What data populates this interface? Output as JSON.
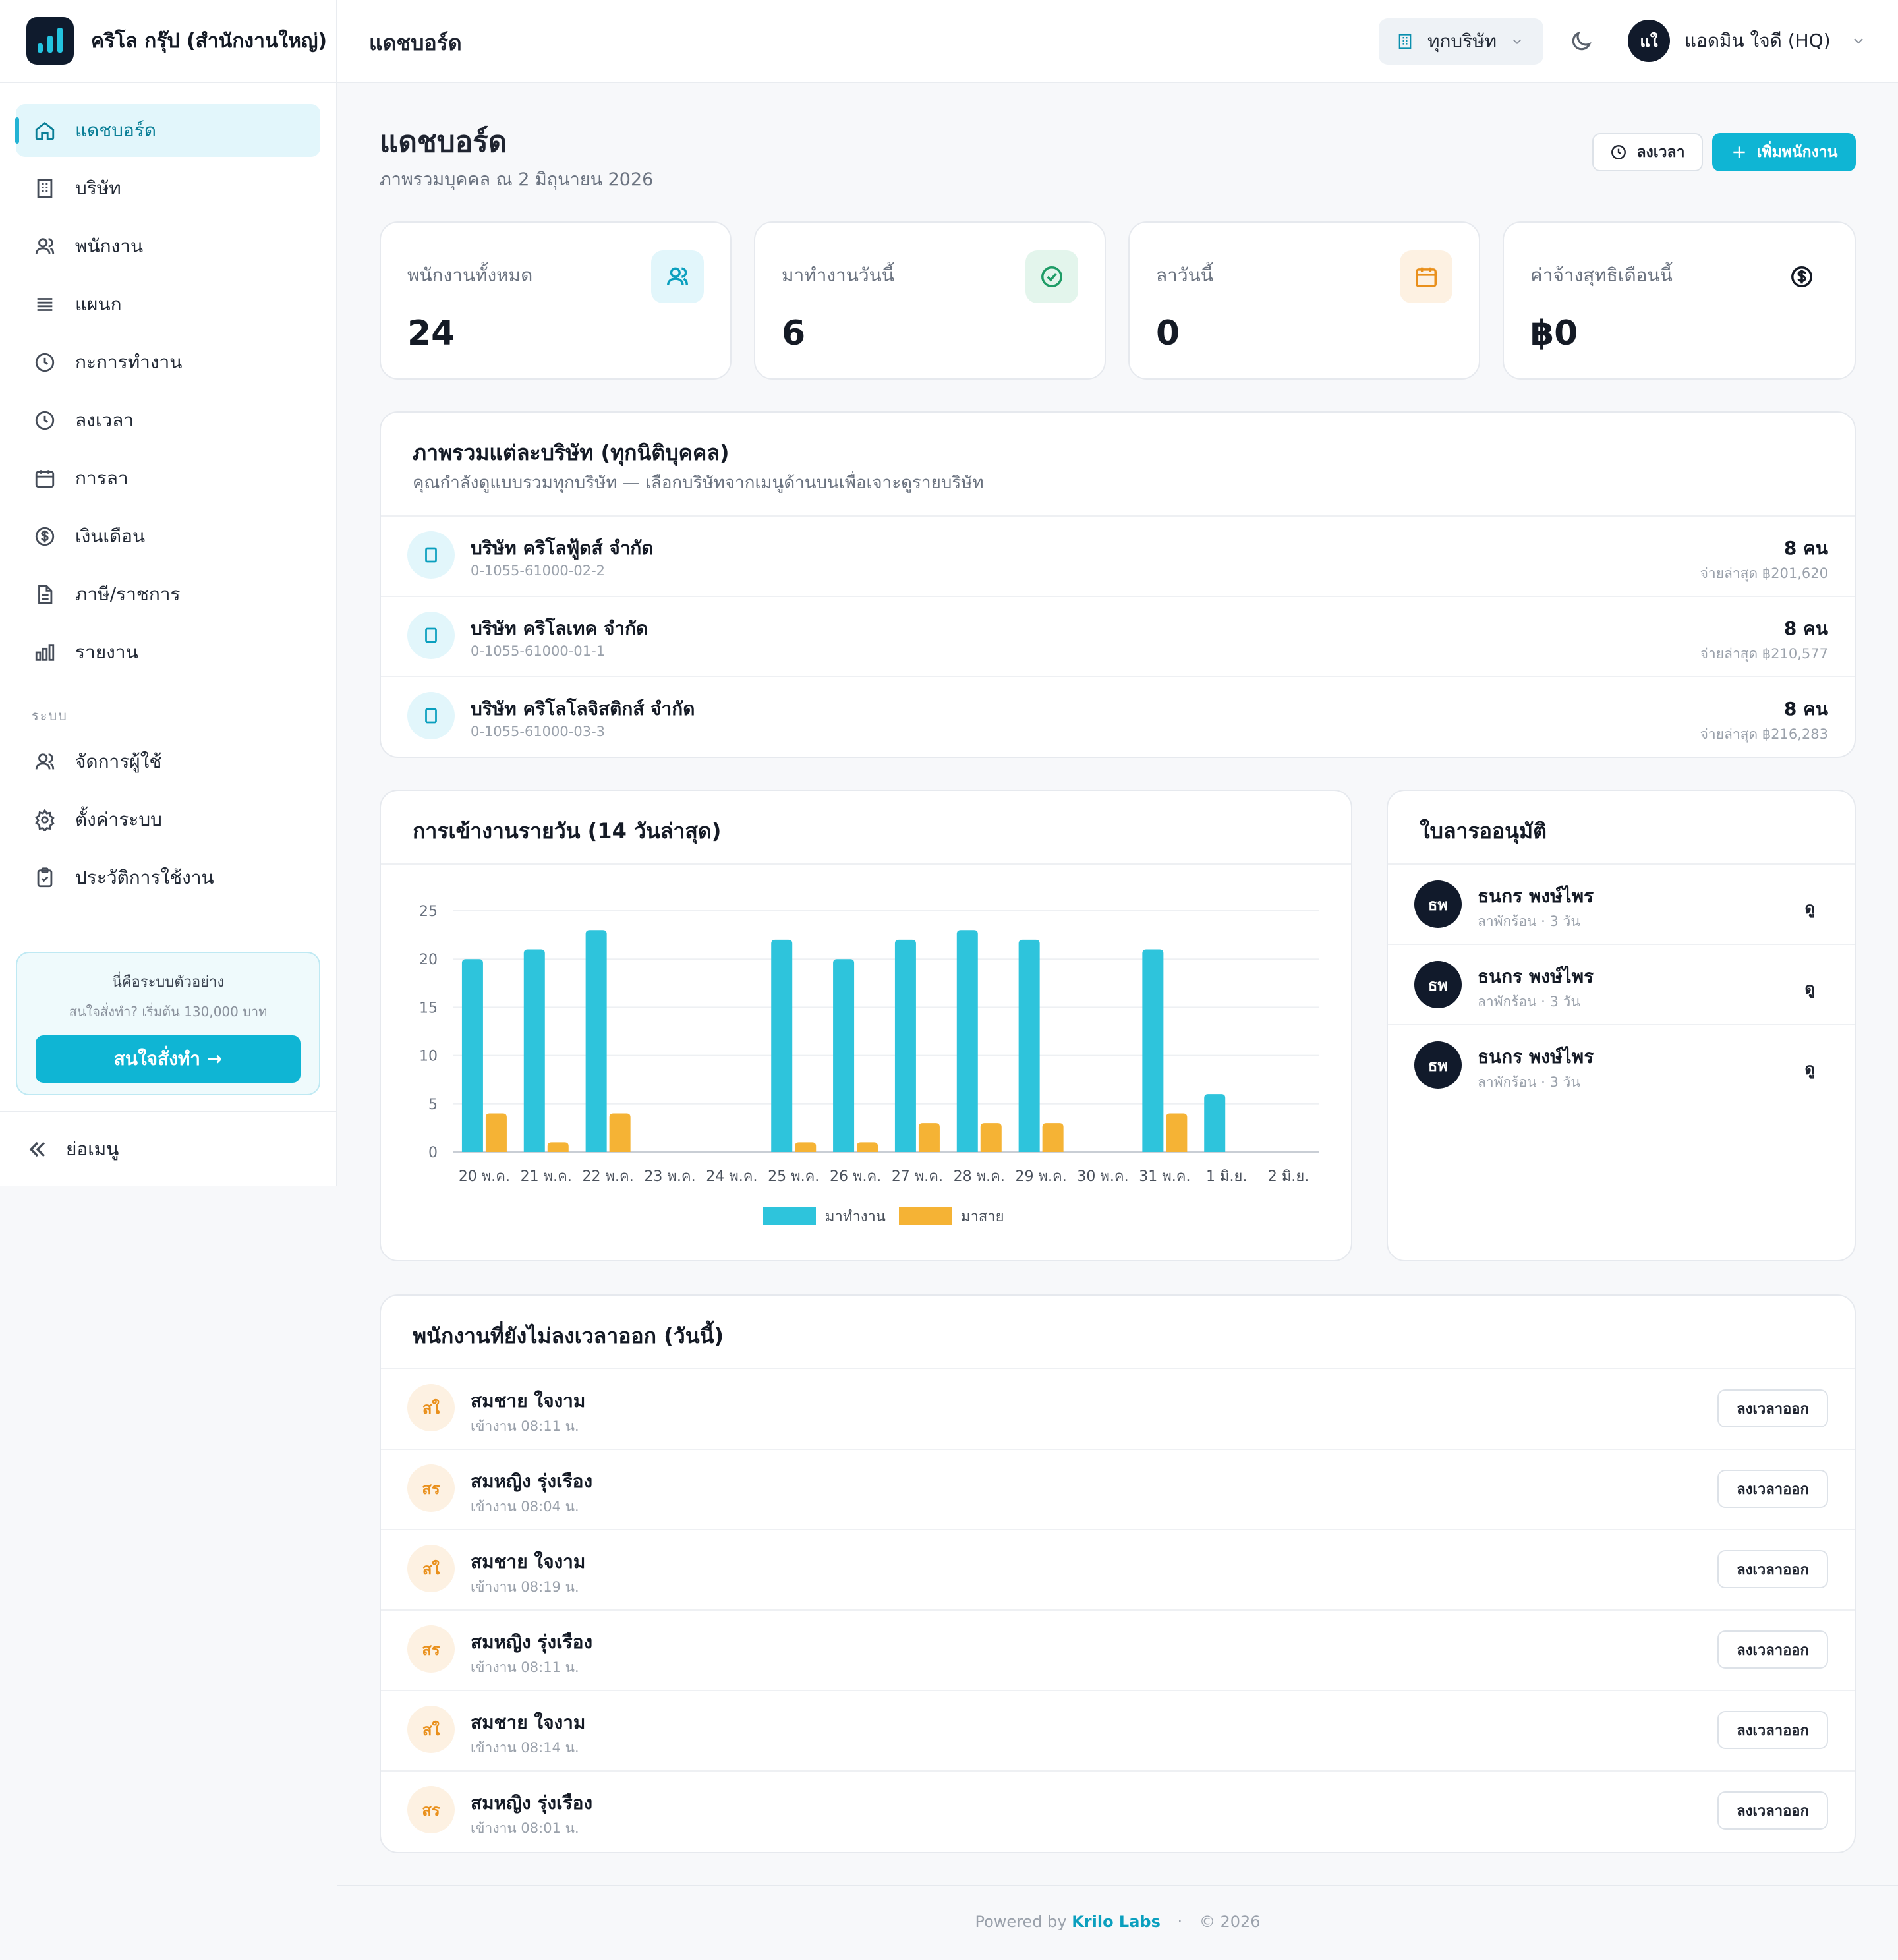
{
  "brand": {
    "name": "คริโล กรุ๊ป (สำนักงานใหญ่)"
  },
  "sidebar": {
    "items": [
      {
        "label": "แดชบอร์ด",
        "icon": "home-icon"
      },
      {
        "label": "บริษัท",
        "icon": "building-icon"
      },
      {
        "label": "พนักงาน",
        "icon": "users-icon"
      },
      {
        "label": "แผนก",
        "icon": "list-icon"
      },
      {
        "label": "กะการทำงาน",
        "icon": "clock-icon"
      },
      {
        "label": "ลงเวลา",
        "icon": "clock-icon"
      },
      {
        "label": "การลา",
        "icon": "calendar-icon"
      },
      {
        "label": "เงินเดือน",
        "icon": "dollar-icon"
      },
      {
        "label": "ภาษี/ราชการ",
        "icon": "document-icon"
      },
      {
        "label": "รายงาน",
        "icon": "bar-chart-icon"
      }
    ],
    "section_label": "ระบบ",
    "system_items": [
      {
        "label": "จัดการผู้ใช้",
        "icon": "users-icon"
      },
      {
        "label": "ตั้งค่าระบบ",
        "icon": "gear-icon"
      },
      {
        "label": "ประวัติการใช้งาน",
        "icon": "clipboard-icon"
      }
    ],
    "promo": {
      "line1": "นี่คือระบบตัวอย่าง",
      "line2": "สนใจสั่งทำ? เริ่มต้น 130,000 บาท",
      "button": "สนใจสั่งทำ →"
    },
    "collapse_label": "ย่อเมนู"
  },
  "topbar": {
    "title": "แดชบอร์ด",
    "company_select": "ทุกบริษัท",
    "user": {
      "initials": "แใ",
      "name": "แอดมิน ใจดี (HQ)"
    }
  },
  "page": {
    "title": "แดชบอร์ด",
    "subtitle": "ภาพรวมบุคคล ณ 2 มิถุนายน 2026",
    "btn_clock": "ลงเวลา",
    "btn_add": "เพิ่มพนักงาน"
  },
  "stats": [
    {
      "label": "พนักงานทั้งหมด",
      "value": "24",
      "icon": "users-icon",
      "color": "#0a9fbe",
      "bg": "#e2f6fb"
    },
    {
      "label": "มาทำงานวันนี้",
      "value": "6",
      "icon": "check-circle-icon",
      "color": "#1e9c66",
      "bg": "#e3f5ec"
    },
    {
      "label": "ลาวันนี้",
      "value": "0",
      "icon": "calendar-icon",
      "color": "#e9901c",
      "bg": "#fdf1e2"
    },
    {
      "label": "ค่าจ้างสุทธิเดือนนี้",
      "value": "฿0",
      "icon": "dollar-icon",
      "color": "#141a25",
      "bg": "#ffffff"
    }
  ],
  "companies": {
    "title": "ภาพรวมแต่ละบริษัท (ทุกนิติบุคคล)",
    "subtitle": "คุณกำลังดูแบบรวมทุกบริษัท — เลือกบริษัทจากเมนูด้านบนเพื่อเจาะดูรายบริษัท",
    "rows": [
      {
        "name": "บริษัท คริโลฟู้ดส์ จำกัด",
        "tax_id": "0-1055-61000-02-2",
        "count": "8 คน",
        "last_pay": "จ่ายล่าสุด ฿201,620"
      },
      {
        "name": "บริษัท คริโลเทค จำกัด",
        "tax_id": "0-1055-61000-01-1",
        "count": "8 คน",
        "last_pay": "จ่ายล่าสุด ฿210,577"
      },
      {
        "name": "บริษัท คริโลโลจิสติกส์ จำกัด",
        "tax_id": "0-1055-61000-03-3",
        "count": "8 คน",
        "last_pay": "จ่ายล่าสุด ฿216,283"
      }
    ]
  },
  "attendance": {
    "title": "การเข้างานรายวัน (14 วันล่าสุด)"
  },
  "chart_data": {
    "type": "bar",
    "categories": [
      "20 พ.ค.",
      "21 พ.ค.",
      "22 พ.ค.",
      "23 พ.ค.",
      "24 พ.ค.",
      "25 พ.ค.",
      "26 พ.ค.",
      "27 พ.ค.",
      "28 พ.ค.",
      "29 พ.ค.",
      "30 พ.ค.",
      "31 พ.ค.",
      "1 มิ.ย.",
      "2 มิ.ย."
    ],
    "series": [
      {
        "name": "มาทำงาน",
        "color": "#2ec4dc",
        "values": [
          20,
          21,
          23,
          0,
          0,
          22,
          20,
          22,
          23,
          22,
          0,
          21,
          6,
          0
        ]
      },
      {
        "name": "มาสาย",
        "color": "#f5b335",
        "values": [
          4,
          1,
          4,
          0,
          0,
          1,
          1,
          3,
          3,
          3,
          0,
          4,
          0,
          0
        ]
      }
    ],
    "ylim": [
      0,
      25
    ],
    "yticks": [
      "0",
      "5",
      "10",
      "15",
      "20",
      "25"
    ],
    "grid": true,
    "legend": "bottom"
  },
  "leave_requests": {
    "title": "ใบลารออนุมัติ",
    "rows": [
      {
        "initials": "ธพ",
        "name": "ธนกร พงษ์ไพร",
        "detail": "ลาพักร้อน · 3 วัน",
        "action": "ดู"
      },
      {
        "initials": "ธพ",
        "name": "ธนกร พงษ์ไพร",
        "detail": "ลาพักร้อน · 3 วัน",
        "action": "ดู"
      },
      {
        "initials": "ธพ",
        "name": "ธนกร พงษ์ไพร",
        "detail": "ลาพักร้อน · 3 วัน",
        "action": "ดู"
      }
    ]
  },
  "not_clocked_out": {
    "title": "พนักงานที่ยังไม่ลงเวลาออก (วันนี้)",
    "rows": [
      {
        "initials": "สใ",
        "name": "สมชาย ใจงาม",
        "checkin": "เข้างาน 08:11 น.",
        "action": "ลงเวลาออก"
      },
      {
        "initials": "สร",
        "name": "สมหญิง รุ่งเรือง",
        "checkin": "เข้างาน 08:04 น.",
        "action": "ลงเวลาออก"
      },
      {
        "initials": "สใ",
        "name": "สมชาย ใจงาม",
        "checkin": "เข้างาน 08:19 น.",
        "action": "ลงเวลาออก"
      },
      {
        "initials": "สร",
        "name": "สมหญิง รุ่งเรือง",
        "checkin": "เข้างาน 08:11 น.",
        "action": "ลงเวลาออก"
      },
      {
        "initials": "สใ",
        "name": "สมชาย ใจงาม",
        "checkin": "เข้างาน 08:14 น.",
        "action": "ลงเวลาออก"
      },
      {
        "initials": "สร",
        "name": "สมหญิง รุ่งเรือง",
        "checkin": "เข้างาน 08:01 น.",
        "action": "ลงเวลาออก"
      }
    ]
  },
  "footer": {
    "powered": "Powered by",
    "company": "Krilo Labs",
    "sep": "·",
    "copyright": "© 2026"
  }
}
